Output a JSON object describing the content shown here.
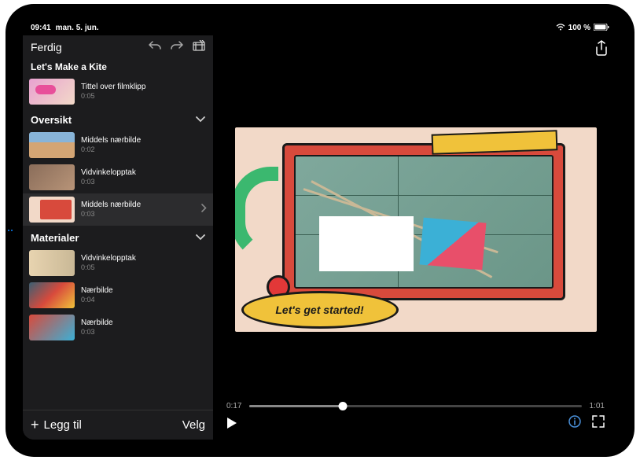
{
  "status": {
    "time": "09:41",
    "date": "man. 5. jun.",
    "battery": "100 %"
  },
  "sidebar": {
    "done": "Ferdig",
    "projectTitle": "Let's Make a Kite",
    "titleClip": {
      "name": "Tittel over filmklipp",
      "duration": "0:05"
    },
    "sections": [
      {
        "title": "Oversikt",
        "clips": [
          {
            "name": "Middels nærbilde",
            "duration": "0:02"
          },
          {
            "name": "Vidvinkelopptak",
            "duration": "0:03"
          },
          {
            "name": "Middels nærbilde",
            "duration": "0:03",
            "selected": true
          }
        ]
      },
      {
        "title": "Materialer",
        "clips": [
          {
            "name": "Vidvinkelopptak",
            "duration": "0:05"
          },
          {
            "name": "Nærbilde",
            "duration": "0:04"
          },
          {
            "name": "Nærbilde",
            "duration": "0:03"
          }
        ]
      }
    ],
    "add": "Legg til",
    "select": "Velg"
  },
  "preview": {
    "bubbleText": "Let's get started!"
  },
  "playback": {
    "current": "0:17",
    "total": "1:01"
  }
}
